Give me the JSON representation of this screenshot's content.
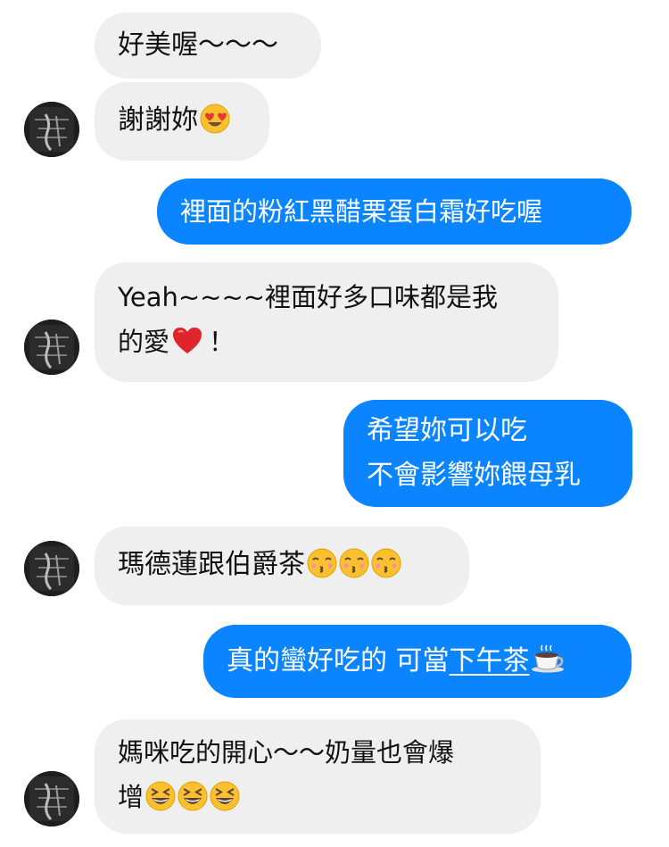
{
  "messages": [
    {
      "id": "m1",
      "side": "incoming",
      "text": "好美喔～～～"
    },
    {
      "id": "m2",
      "side": "incoming",
      "text": "謝謝妳",
      "emoji": "heart-eyes-emoji"
    },
    {
      "id": "m3",
      "side": "outgoing",
      "text": "裡面的粉紅黑醋栗蛋白霜好吃喔"
    },
    {
      "id": "m4",
      "side": "incoming",
      "line1": "Yeah~~~~裡面好多口味都是我",
      "line2_text": "的愛",
      "line2_emoji": "red-heart-emoji",
      "line2_after": "！"
    },
    {
      "id": "m5",
      "side": "outgoing",
      "line1": "希望妳可以吃",
      "line2": "不會影響妳餵母乳"
    },
    {
      "id": "m6",
      "side": "incoming",
      "text": "瑪德蓮跟伯爵茶",
      "emoji": "kissing-emoji",
      "emoji_count": 3
    },
    {
      "id": "m7",
      "side": "outgoing",
      "text_before": "真的蠻好吃的 可當",
      "underlined": "下午茶",
      "emoji": "hot-beverage-emoji"
    },
    {
      "id": "m8",
      "side": "incoming",
      "line1": "媽咪吃的開心～～奶量也會爆",
      "line2_text": "增",
      "emoji": "grinning-squinting-emoji",
      "emoji_count": 3
    }
  ],
  "colors": {
    "incoming_bubble": "#efefef",
    "outgoing_bubble": "#0a84ff",
    "incoming_text": "#111111",
    "outgoing_text": "#ffffff"
  }
}
